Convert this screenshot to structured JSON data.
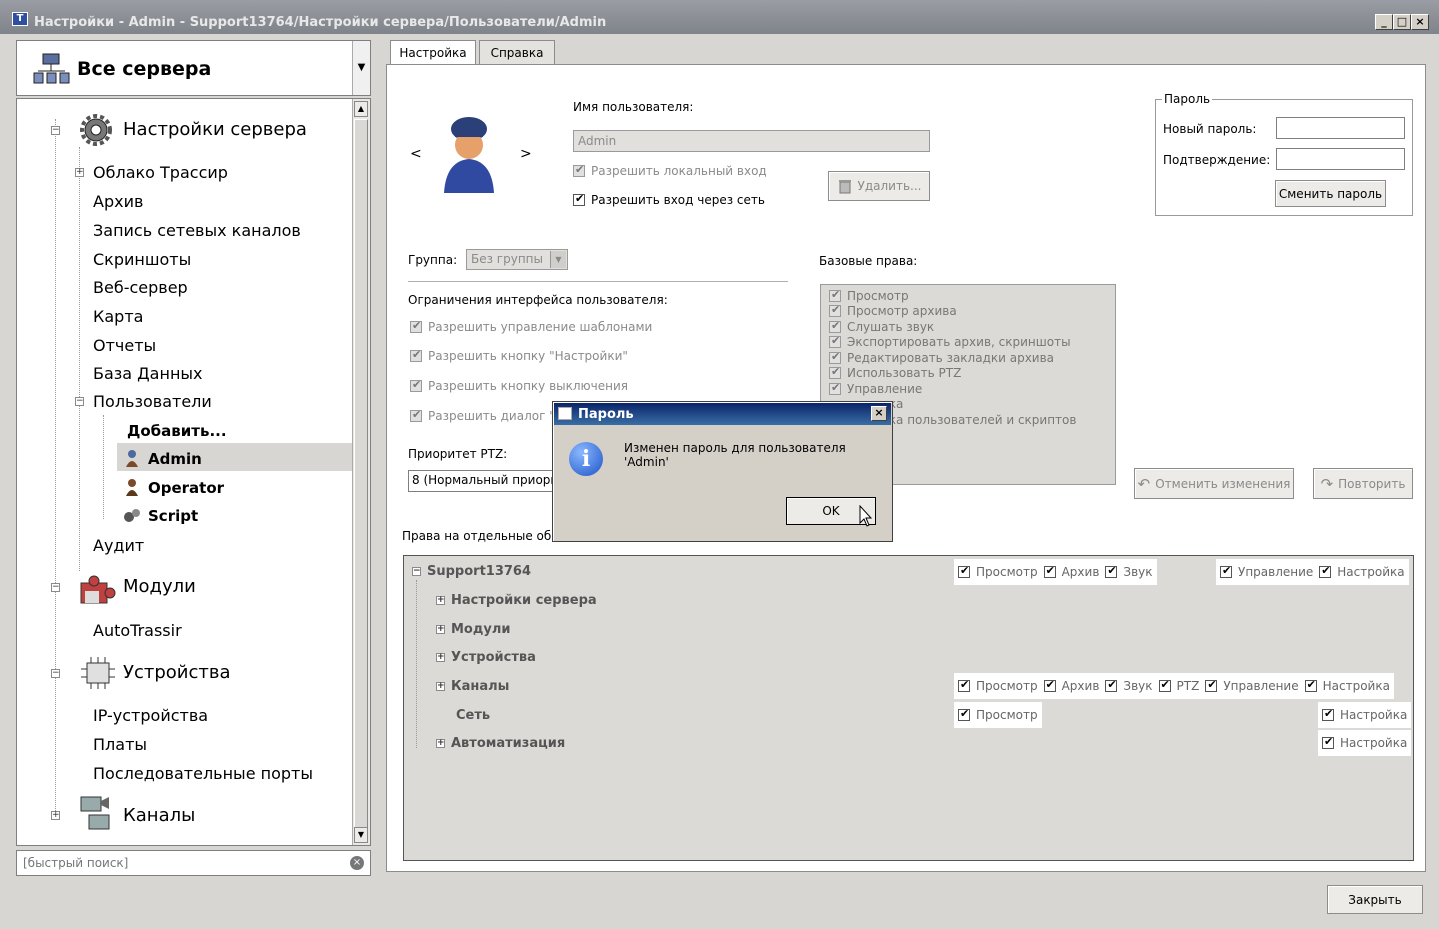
{
  "window": {
    "title": "Настройки - Admin - Support13764/Настройки сервера/Пользователи/Admin",
    "buttons": [
      "_",
      "□",
      "×"
    ]
  },
  "server_selector": {
    "label": "Все сервера"
  },
  "tree": {
    "items": [
      {
        "label": "Настройки сервера"
      },
      {
        "label": "Облако Трассир"
      },
      {
        "label": "Архив"
      },
      {
        "label": "Запись сетевых каналов"
      },
      {
        "label": "Скриншоты"
      },
      {
        "label": "Веб-сервер"
      },
      {
        "label": "Карта"
      },
      {
        "label": "Отчеты"
      },
      {
        "label": "База Данных"
      },
      {
        "label": "Пользователи"
      },
      {
        "label": "Добавить..."
      },
      {
        "label": "Admin"
      },
      {
        "label": "Operator"
      },
      {
        "label": "Script"
      },
      {
        "label": "Аудит"
      },
      {
        "label": "Модули"
      },
      {
        "label": "AutoTrassir"
      },
      {
        "label": "Устройства"
      },
      {
        "label": "IP-устройства"
      },
      {
        "label": "Платы"
      },
      {
        "label": "Последовательные порты"
      },
      {
        "label": "Каналы"
      }
    ]
  },
  "search": {
    "placeholder": "[быстрый поиск]"
  },
  "tabs": [
    {
      "label": "Настройка"
    },
    {
      "label": "Справка"
    }
  ],
  "user": {
    "prev": "<",
    "next": ">",
    "name_label": "Имя пользователя:",
    "name_value": "Admin",
    "allow_local": "Разрешить локальный вход",
    "allow_network": "Разрешить вход через сеть",
    "delete_label": "Удалить..."
  },
  "password_box": {
    "legend": "Пароль",
    "new_label": "Новый пароль:",
    "confirm_label": "Подтверждение:",
    "change_button": "Сменить пароль"
  },
  "group": {
    "label": "Группа:",
    "value": "Без группы"
  },
  "ui_limits": {
    "heading": "Ограничения интерфейса пользователя:",
    "items": [
      "Разрешить управление шаблонами",
      "Разрешить кнопку \"Настройки\"",
      "Разрешить кнопку выключения",
      "Разрешить диалог \""
    ]
  },
  "ptz": {
    "label": "Приоритет PTZ:",
    "value": "8 (Нормальный приори"
  },
  "base_rights": {
    "heading": "Базовые права:",
    "items": [
      "Просмотр",
      "Просмотр архива",
      "Слушать звук",
      "Экспортировать архив, скриншоты",
      "Редактировать закладки архива",
      "Использовать PTZ",
      "Управление",
      "ика",
      "ика пользователей и скриптов"
    ]
  },
  "actions": {
    "undo": "Отменить изменения",
    "redo": "Повторить"
  },
  "objects": {
    "heading": "Права на отдельные об",
    "root": "Support13764",
    "children": [
      "Настройки сервера",
      "Модули",
      "Устройства",
      "Каналы",
      "Сеть",
      "Автоматизация"
    ],
    "perm": {
      "view": "Просмотр",
      "archive": "Архив",
      "sound": "Звук",
      "ptz": "PTZ",
      "control": "Управление",
      "settings": "Настройка"
    }
  },
  "dialog": {
    "title": "Пароль",
    "message": "Изменен пароль для пользователя 'Admin'",
    "ok": "OK"
  },
  "close_button": "Закрыть",
  "colors": {
    "title_bar": "#8b8e94",
    "dialog_title": "#0a246a",
    "info_icon": "#1d54c8"
  }
}
